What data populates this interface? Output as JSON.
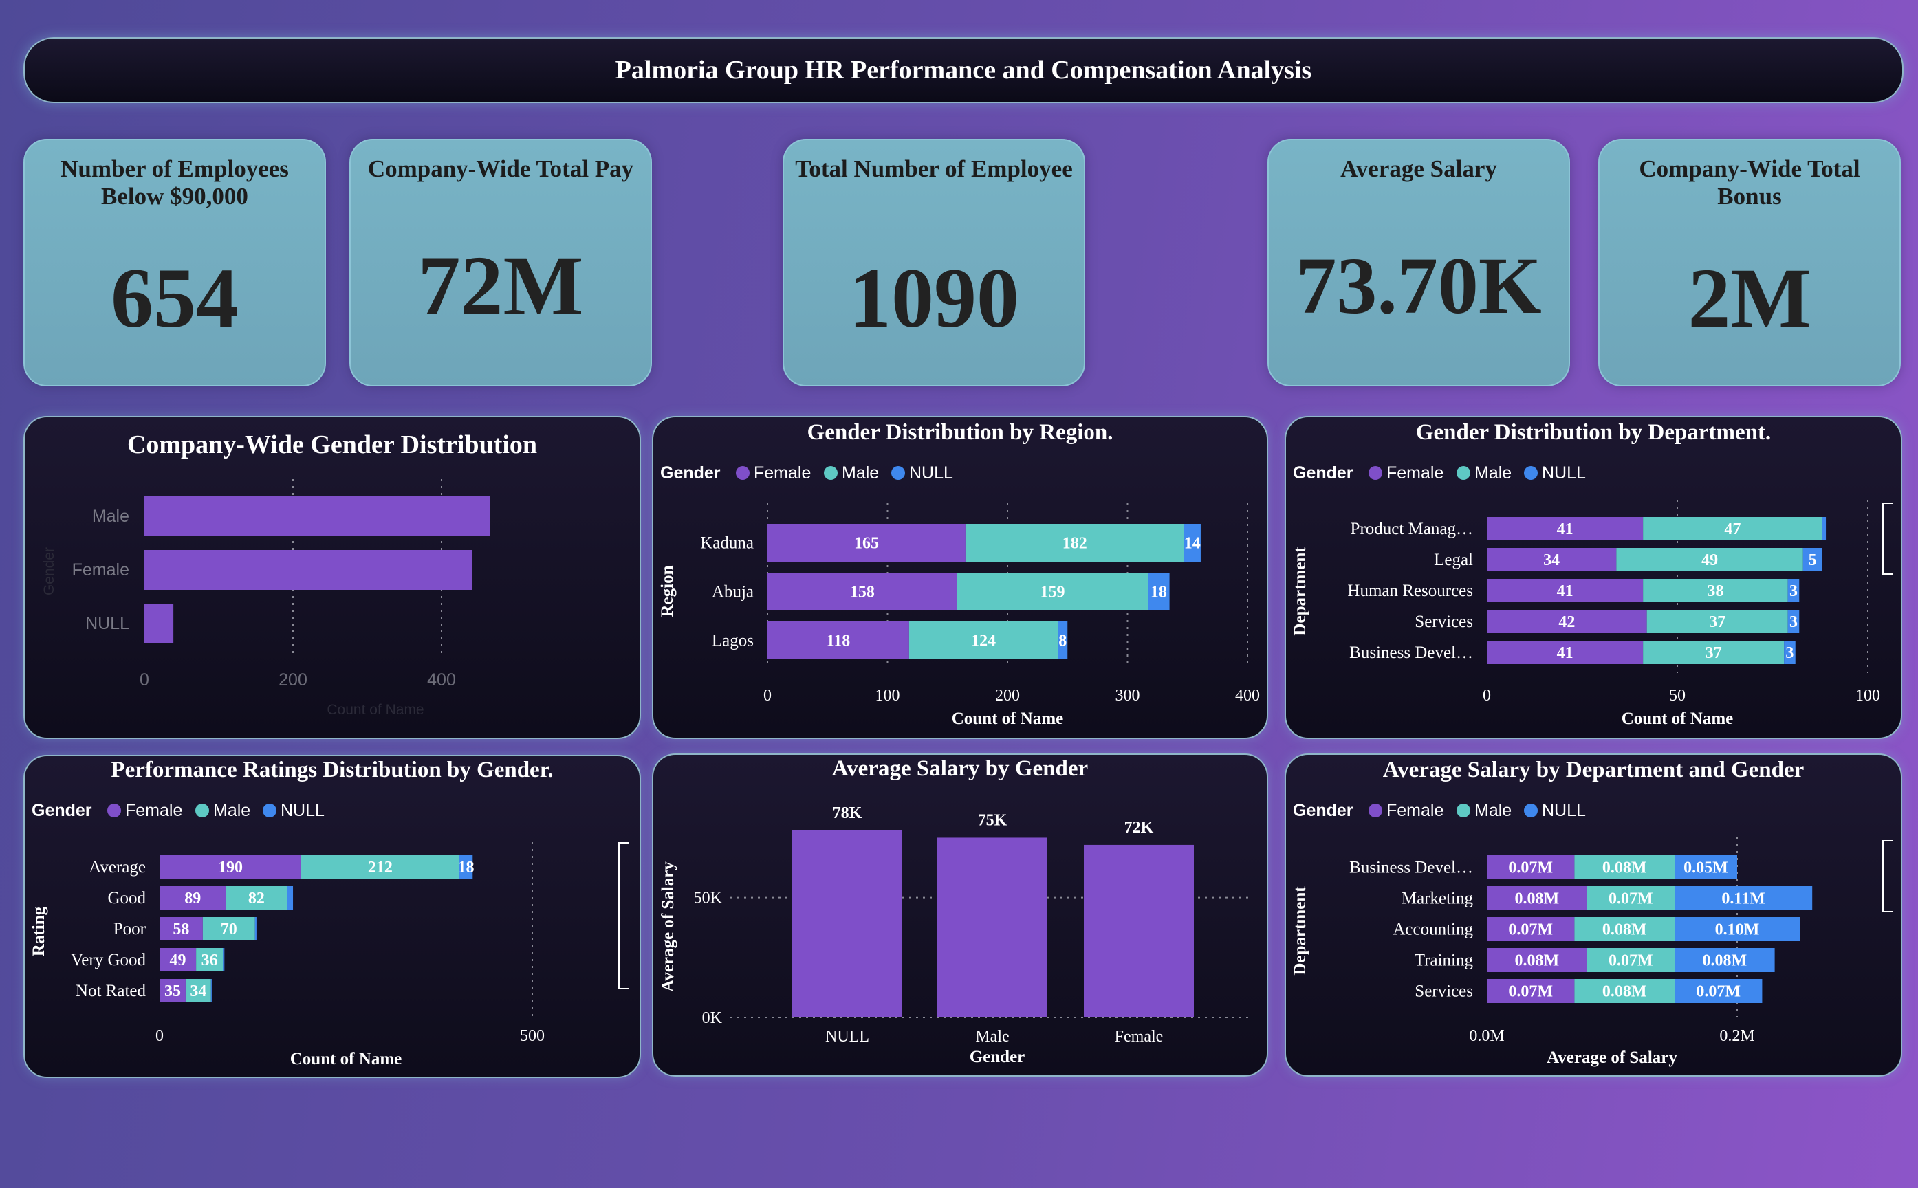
{
  "page_title": "Palmoria Group HR Performance and Compensation Analysis",
  "kpis": {
    "below_90k": {
      "label": "Number of Employees Below $90,000",
      "value": "654"
    },
    "total_pay": {
      "label": "Company-Wide Total Pay",
      "value": "72M"
    },
    "total_employees": {
      "label": "Total Number of Employee",
      "value": "1090"
    },
    "average_salary": {
      "label": "Average Salary",
      "value": "73.70K"
    },
    "total_bonus": {
      "label": "Company-Wide Total Bonus",
      "value": "2M"
    }
  },
  "legend": {
    "title": "Gender",
    "female": "Female",
    "male": "Male",
    "null": "NULL"
  },
  "colors": {
    "female": "#7f4fc9",
    "male": "#5ec9c4",
    "null": "#3f88ee"
  },
  "chart_data": [
    {
      "id": "gender_distribution",
      "type": "bar",
      "orientation": "horizontal",
      "title": "Company-Wide Gender Distribution",
      "categories": [
        "Male",
        "Female",
        "NULL"
      ],
      "values": [
        465,
        441,
        39
      ],
      "xlabel": "Count of Name",
      "ylabel": "Gender",
      "xlim": [
        0,
        500
      ],
      "x_ticks": [
        "0",
        "200",
        "400"
      ]
    },
    {
      "id": "gender_by_region",
      "type": "bar",
      "orientation": "horizontal",
      "stacked": true,
      "title": "Gender Distribution by Region.",
      "categories": [
        "Kaduna",
        "Abuja",
        "Lagos"
      ],
      "series": [
        {
          "name": "Female",
          "values": [
            165,
            158,
            118
          ]
        },
        {
          "name": "Male",
          "values": [
            182,
            159,
            124
          ]
        },
        {
          "name": "NULL",
          "values": [
            14,
            18,
            8
          ]
        }
      ],
      "xlabel": "Count of Name",
      "ylabel": "Region",
      "xlim": [
        0,
        400
      ],
      "x_ticks": [
        "0",
        "100",
        "200",
        "300",
        "400"
      ]
    },
    {
      "id": "gender_by_department",
      "type": "bar",
      "orientation": "horizontal",
      "stacked": true,
      "title": "Gender Distribution by Department.",
      "categories": [
        "Product Manag…",
        "Legal",
        "Human Resources",
        "Services",
        "Business Devel…"
      ],
      "series": [
        {
          "name": "Female",
          "values": [
            41,
            34,
            41,
            42,
            41
          ]
        },
        {
          "name": "Male",
          "values": [
            47,
            49,
            38,
            37,
            37
          ]
        },
        {
          "name": "NULL",
          "values": [
            1,
            5,
            3,
            3,
            3
          ]
        }
      ],
      "xlabel": "Count of Name",
      "ylabel": "Department",
      "xlim": [
        0,
        100
      ],
      "x_ticks": [
        "0",
        "50",
        "100"
      ]
    },
    {
      "id": "ratings_by_gender",
      "type": "bar",
      "orientation": "horizontal",
      "stacked": true,
      "title": "Performance Ratings Distribution by Gender.",
      "categories": [
        "Average",
        "Good",
        "Poor",
        "Very Good",
        "Not Rated"
      ],
      "series": [
        {
          "name": "Female",
          "values": [
            190,
            89,
            58,
            49,
            35
          ]
        },
        {
          "name": "Male",
          "values": [
            212,
            82,
            70,
            36,
            34
          ]
        },
        {
          "name": "NULL",
          "values": [
            18,
            8,
            2,
            2,
            1
          ]
        }
      ],
      "xlabel": "Count of Name",
      "ylabel": "Rating",
      "xlim": [
        0,
        500
      ],
      "x_ticks": [
        "0",
        "500"
      ]
    },
    {
      "id": "avg_salary_by_gender",
      "type": "bar",
      "orientation": "vertical",
      "title": "Average Salary by Gender",
      "categories": [
        "NULL",
        "Male",
        "Female"
      ],
      "values": [
        78,
        75,
        72
      ],
      "data_labels": [
        "78K",
        "75K",
        "72K"
      ],
      "xlabel": "Gender",
      "ylabel": "Average of Salary",
      "ylim": [
        0,
        78
      ],
      "y_ticks": [
        {
          "label": "0K",
          "value": 0
        },
        {
          "label": "50K",
          "value": 50
        }
      ]
    },
    {
      "id": "avg_salary_by_dept_gender",
      "type": "bar",
      "orientation": "horizontal",
      "stacked": true,
      "title": "Average Salary by Department and Gender",
      "categories": [
        "Business Devel…",
        "Marketing",
        "Accounting",
        "Training",
        "Services"
      ],
      "series": [
        {
          "name": "Female",
          "values": [
            0.07,
            0.08,
            0.07,
            0.08,
            0.07
          ],
          "labels": [
            "0.07M",
            "0.08M",
            "0.07M",
            "0.08M",
            "0.07M"
          ]
        },
        {
          "name": "Male",
          "values": [
            0.08,
            0.07,
            0.08,
            0.07,
            0.08
          ],
          "labels": [
            "0.08M",
            "0.07M",
            "0.08M",
            "0.07M",
            "0.08M"
          ]
        },
        {
          "name": "NULL",
          "values": [
            0.05,
            0.11,
            0.1,
            0.08,
            0.07
          ],
          "labels": [
            "0.05M",
            "0.11M",
            "0.10M",
            "0.08M",
            "0.07M"
          ]
        }
      ],
      "xlabel": "Average of Salary",
      "ylabel": "Department",
      "xlim": [
        0,
        0.2
      ],
      "x_ticks": [
        "0.0M",
        "0.2M"
      ]
    }
  ]
}
